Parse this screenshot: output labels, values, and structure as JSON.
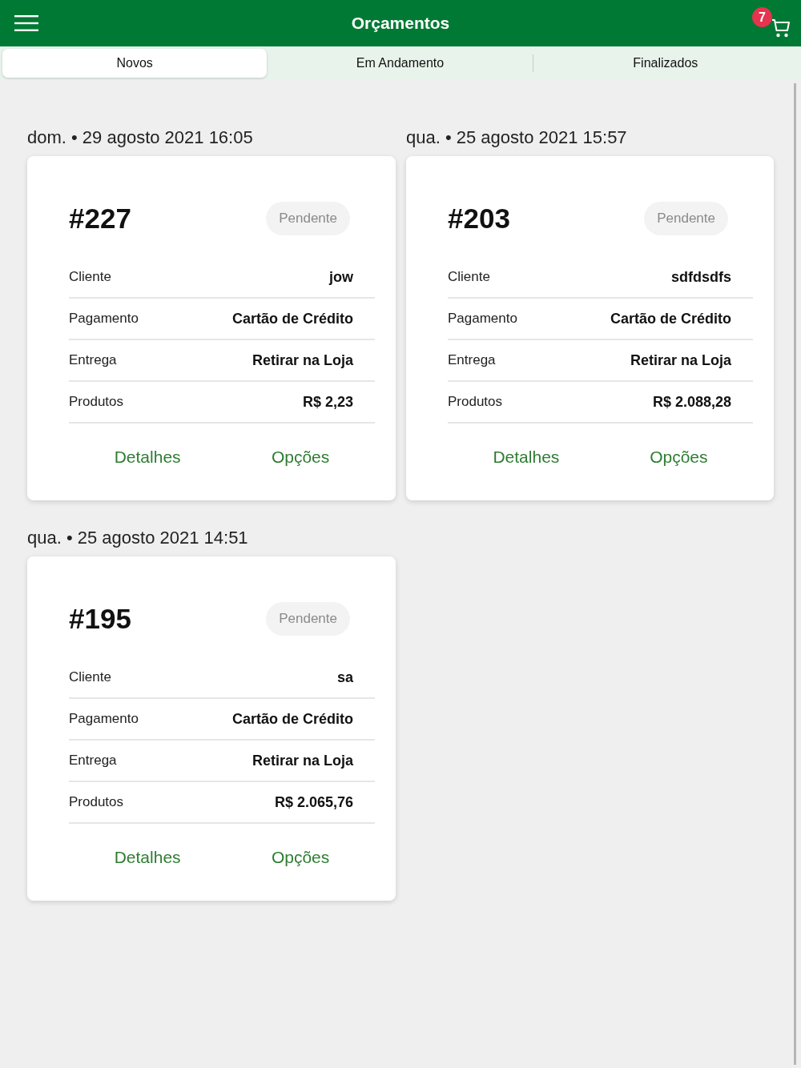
{
  "header": {
    "title": "Orçamentos",
    "cart_badge": "7"
  },
  "tabs": [
    {
      "label": "Novos",
      "selected": true
    },
    {
      "label": "Em Andamento",
      "selected": false
    },
    {
      "label": "Finalizados",
      "selected": false
    }
  ],
  "orders": [
    {
      "date": "dom. • 29 agosto 2021 16:05",
      "number": "#227",
      "status": "Pendente",
      "fields": [
        {
          "label": "Cliente",
          "value": "jow"
        },
        {
          "label": "Pagamento",
          "value": "Cartão de Crédito"
        },
        {
          "label": "Entrega",
          "value": "Retirar na Loja"
        },
        {
          "label": "Produtos",
          "value": "R$ 2,23"
        }
      ],
      "actions": [
        "Detalhes",
        "Opções"
      ]
    },
    {
      "date": "qua. • 25 agosto 2021 15:57",
      "number": "#203",
      "status": "Pendente",
      "fields": [
        {
          "label": "Cliente",
          "value": "sdfdsdfs"
        },
        {
          "label": "Pagamento",
          "value": "Cartão de Crédito"
        },
        {
          "label": "Entrega",
          "value": "Retirar na Loja"
        },
        {
          "label": "Produtos",
          "value": "R$ 2.088,28"
        }
      ],
      "actions": [
        "Detalhes",
        "Opções"
      ]
    },
    {
      "date": "qua. • 25 agosto 2021 14:51",
      "number": "#195",
      "status": "Pendente",
      "fields": [
        {
          "label": "Cliente",
          "value": "sa"
        },
        {
          "label": "Pagamento",
          "value": "Cartão de Crédito"
        },
        {
          "label": "Entrega",
          "value": "Retirar na Loja"
        },
        {
          "label": "Produtos",
          "value": "R$ 2.065,76"
        }
      ],
      "actions": [
        "Detalhes",
        "Opções"
      ]
    }
  ]
}
